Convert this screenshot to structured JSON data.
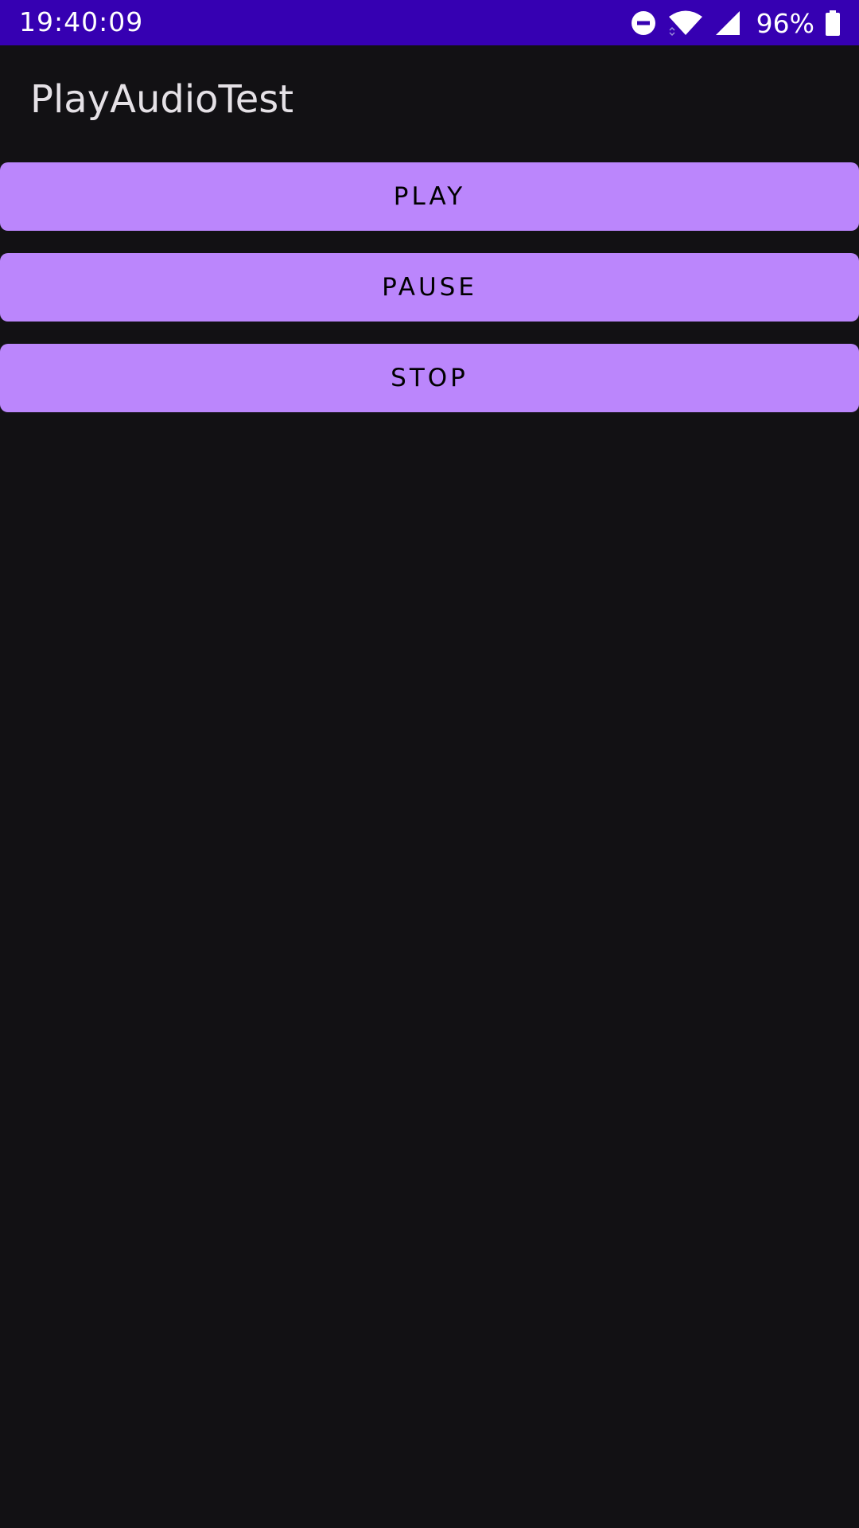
{
  "status_bar": {
    "time": "19:40:09",
    "battery_percent": "96%",
    "icons": [
      "do-not-disturb-icon",
      "wifi-icon",
      "cell-signal-icon",
      "battery-icon"
    ],
    "background_color": "#3600b2"
  },
  "app_bar": {
    "title": "PlayAudioTest"
  },
  "buttons": {
    "play_label": "PLAY",
    "pause_label": "PAUSE",
    "stop_label": "STOP",
    "color": "#bb86fc"
  },
  "theme": {
    "background": "#121114",
    "title_color": "#e5e1e6"
  }
}
